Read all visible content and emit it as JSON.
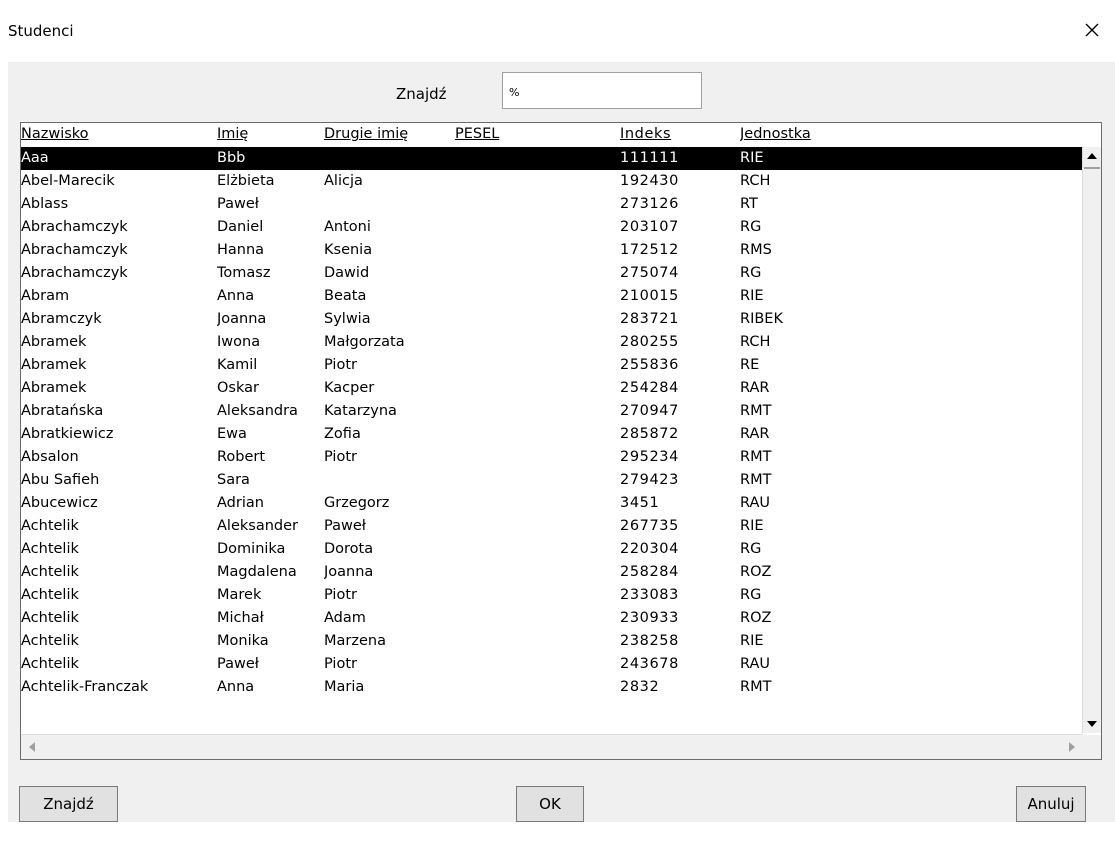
{
  "window": {
    "title": "Studenci",
    "close_icon": "close-icon"
  },
  "search": {
    "label": "Znajdź",
    "value": "%"
  },
  "table": {
    "columns": [
      "Nazwisko",
      "Imię",
      "Drugie imię",
      "PESEL",
      "Indeks",
      "Jednostka"
    ],
    "selected_row": 0,
    "rows": [
      [
        "Aaa",
        "Bbb",
        "",
        "",
        "111111",
        "RIE"
      ],
      [
        "Abel-Marecik",
        "Elżbieta",
        "Alicja",
        "",
        "192430",
        "RCH"
      ],
      [
        "Ablass",
        "Paweł",
        "",
        "",
        "273126",
        "RT"
      ],
      [
        "Abrachamczyk",
        "Daniel",
        "Antoni",
        "",
        "203107",
        "RG"
      ],
      [
        "Abrachamczyk",
        "Hanna",
        "Ksenia",
        "",
        "172512",
        "RMS"
      ],
      [
        "Abrachamczyk",
        "Tomasz",
        "Dawid",
        "",
        "275074",
        "RG"
      ],
      [
        "Abram",
        "Anna",
        "Beata",
        "",
        "210015",
        "RIE"
      ],
      [
        "Abramczyk",
        "Joanna",
        "Sylwia",
        "",
        "283721",
        "RIBEK"
      ],
      [
        "Abramek",
        "Iwona",
        "Małgorzata",
        "",
        "280255",
        "RCH"
      ],
      [
        "Abramek",
        "Kamil",
        "Piotr",
        "",
        "255836",
        "RE"
      ],
      [
        "Abramek",
        "Oskar",
        "Kacper",
        "",
        "254284",
        "RAR"
      ],
      [
        "Abratańska",
        "Aleksandra",
        "Katarzyna",
        "",
        "270947",
        "RMT"
      ],
      [
        "Abratkiewicz",
        "Ewa",
        "Zofia",
        "",
        "285872",
        "RAR"
      ],
      [
        "Absalon",
        "Robert",
        "Piotr",
        "",
        "295234",
        "RMT"
      ],
      [
        "Abu Safieh",
        "Sara",
        "",
        "",
        "279423",
        "RMT"
      ],
      [
        "Abucewicz",
        "Adrian",
        "Grzegorz",
        "",
        "3451",
        "RAU"
      ],
      [
        "Achtelik",
        "Aleksander",
        "Paweł",
        "",
        "267735",
        "RIE"
      ],
      [
        "Achtelik",
        "Dominika",
        "Dorota",
        "",
        "220304",
        "RG"
      ],
      [
        "Achtelik",
        "Magdalena",
        "Joanna",
        "",
        "258284",
        "ROZ"
      ],
      [
        "Achtelik",
        "Marek",
        "Piotr",
        "",
        "233083",
        "RG"
      ],
      [
        "Achtelik",
        "Michał",
        "Adam",
        "",
        "230933",
        "ROZ"
      ],
      [
        "Achtelik",
        "Monika",
        "Marzena",
        "",
        "238258",
        "RIE"
      ],
      [
        "Achtelik",
        "Paweł",
        "Piotr",
        "",
        "243678",
        "RAU"
      ],
      [
        "Achtelik-Franczak",
        "Anna",
        "Maria",
        "",
        "2832",
        "RMT"
      ]
    ]
  },
  "buttons": {
    "find": "Znajdź",
    "ok": "OK",
    "cancel": "Anuluj"
  }
}
